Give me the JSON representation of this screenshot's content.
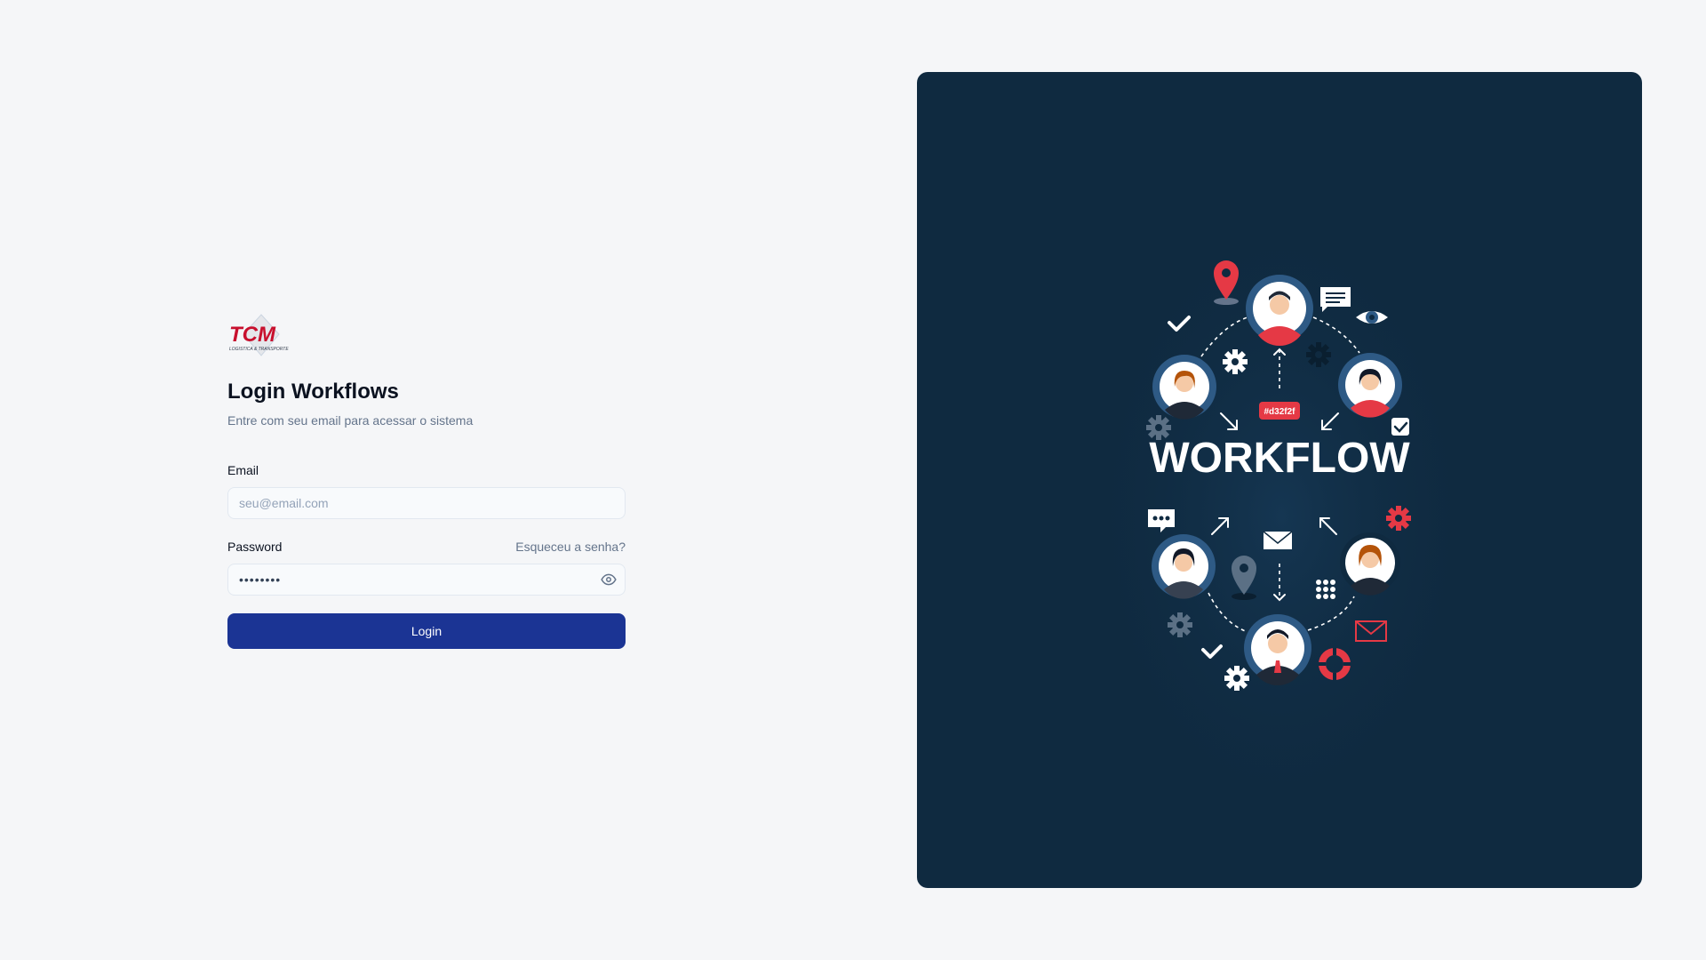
{
  "brand": {
    "logo_text": "TCM",
    "logo_tagline": "LOGISTICA & TRANSPORTE",
    "color_primary": "#d32f2f"
  },
  "login": {
    "title": "Login Workflows",
    "subtitle": "Entre com seu email para acessar o sistema",
    "email_label": "Email",
    "email_placeholder": "seu@email.com",
    "email_value": "",
    "password_label": "Password",
    "forgot_label": "Esqueceu a senha?",
    "password_value": "••••••••",
    "submit_label": "Login"
  },
  "illustration": {
    "heading": "WORKFLOW",
    "badge": "#d32f2f",
    "accent_red": "#e53945",
    "panel_bg": "#0f2a40",
    "ring_blue": "#2e5a85"
  },
  "colors": {
    "button_bg": "#1b3494",
    "page_bg": "#f5f6f8"
  }
}
